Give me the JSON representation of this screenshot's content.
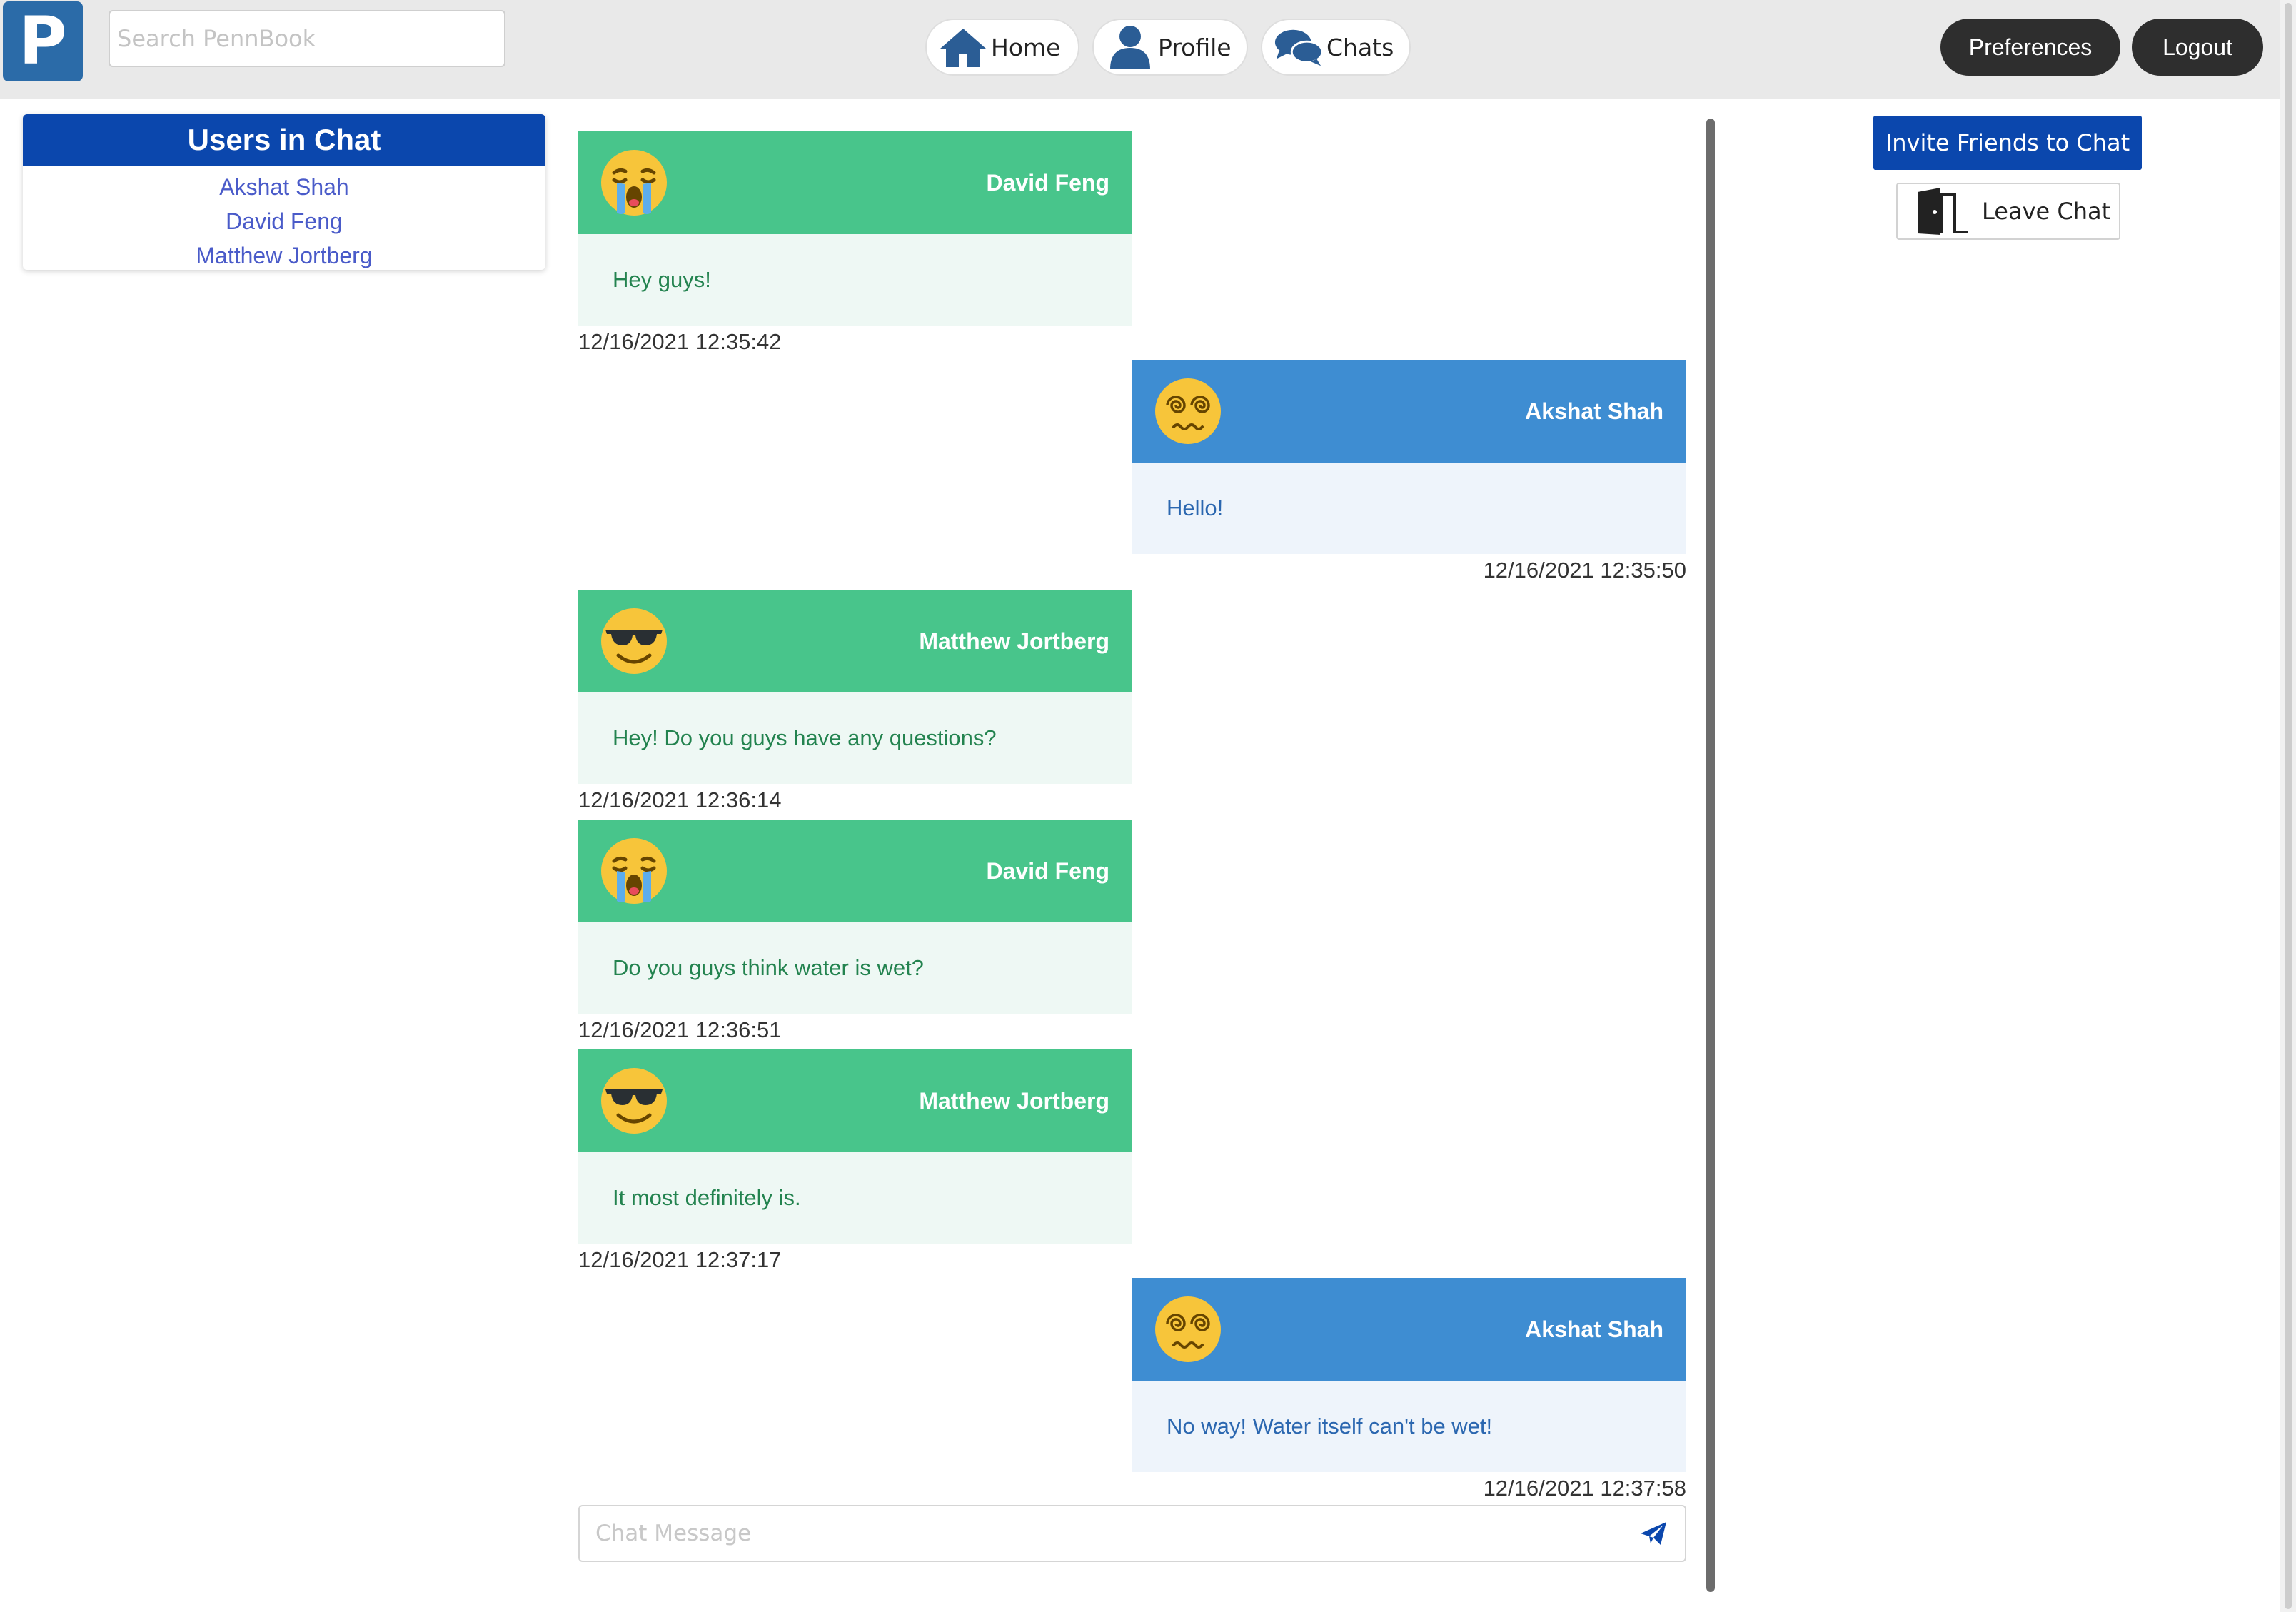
{
  "header": {
    "logo_letter": "P",
    "search_placeholder": "Search PennBook",
    "nav": [
      {
        "label": "Home",
        "icon": "home-icon"
      },
      {
        "label": "Profile",
        "icon": "user-icon"
      },
      {
        "label": "Chats",
        "icon": "chat-bubbles-icon"
      }
    ],
    "preferences_label": "Preferences",
    "logout_label": "Logout"
  },
  "users_panel": {
    "title": "Users in Chat",
    "users": [
      "Akshat Shah",
      "David Feng",
      "Matthew Jortberg"
    ]
  },
  "messages": [
    {
      "sender": "David Feng",
      "text": "Hey guys!",
      "time": "12/16/2021 12:35:42",
      "side": "left",
      "avatar": "crying-face-emoji"
    },
    {
      "sender": "Akshat Shah",
      "text": "Hello!",
      "time": "12/16/2021 12:35:50",
      "side": "right",
      "avatar": "dizzy-face-emoji"
    },
    {
      "sender": "Matthew Jortberg",
      "text": "Hey! Do you guys have any questions?",
      "time": "12/16/2021 12:36:14",
      "side": "left",
      "avatar": "sunglasses-face-emoji"
    },
    {
      "sender": "David Feng",
      "text": "Do you guys think water is wet?",
      "time": "12/16/2021 12:36:51",
      "side": "left",
      "avatar": "crying-face-emoji"
    },
    {
      "sender": "Matthew Jortberg",
      "text": "It most definitely is.",
      "time": "12/16/2021 12:37:17",
      "side": "left",
      "avatar": "sunglasses-face-emoji"
    },
    {
      "sender": "Akshat Shah",
      "text": "No way! Water itself can't be wet!",
      "time": "12/16/2021 12:37:58",
      "side": "right",
      "avatar": "dizzy-face-emoji"
    }
  ],
  "composer": {
    "placeholder": "Chat Message",
    "send_icon": "paper-plane-icon"
  },
  "actions": {
    "invite_label": "Invite Friends to Chat",
    "leave_label": "Leave Chat",
    "leave_icon": "door-icon"
  },
  "colors": {
    "brand_blue": "#0b47ad",
    "left_bubble": "#48c58b",
    "right_bubble": "#3e8dd2"
  }
}
